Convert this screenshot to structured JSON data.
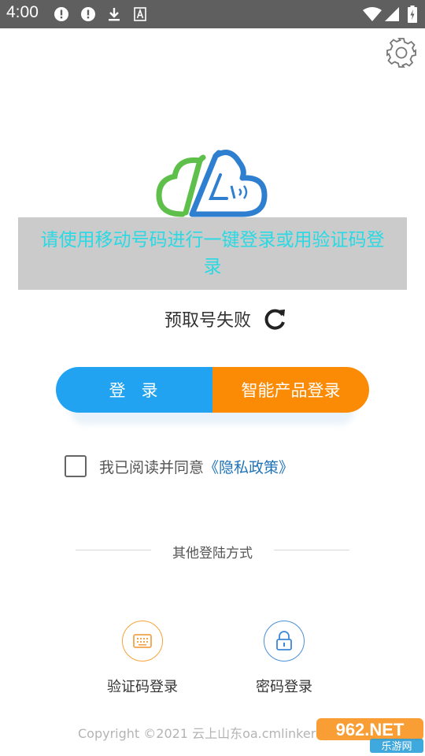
{
  "status_bar": {
    "time": "4:00"
  },
  "toast": {
    "message": "请使用移动号码进行一键登录或用验证码登录"
  },
  "prefetch": {
    "text": "预取号失败"
  },
  "buttons": {
    "login": "登录",
    "smart_login": "智能产品登录"
  },
  "agreement": {
    "text": "我已阅读并同意",
    "policy_link": "《隐私政策》"
  },
  "other_methods": {
    "label": "其他登陆方式",
    "sms_login": "验证码登录",
    "password_login": "密码登录"
  },
  "footer": {
    "copyright": "Copyright ©2021 云上山东oa.cmlinker"
  },
  "watermark": {
    "brand": "962.NET",
    "sub": "乐游网"
  },
  "colors": {
    "status_bar": "#5f5f5f",
    "login_blue": "#22a3f2",
    "smart_orange": "#fb8a05",
    "toast_text": "#29d9e3",
    "link_blue": "#1e72b8"
  },
  "icons": {
    "settings": "gear-icon",
    "refresh": "refresh-icon",
    "sms": "keyboard-icon",
    "password": "lock-icon"
  }
}
